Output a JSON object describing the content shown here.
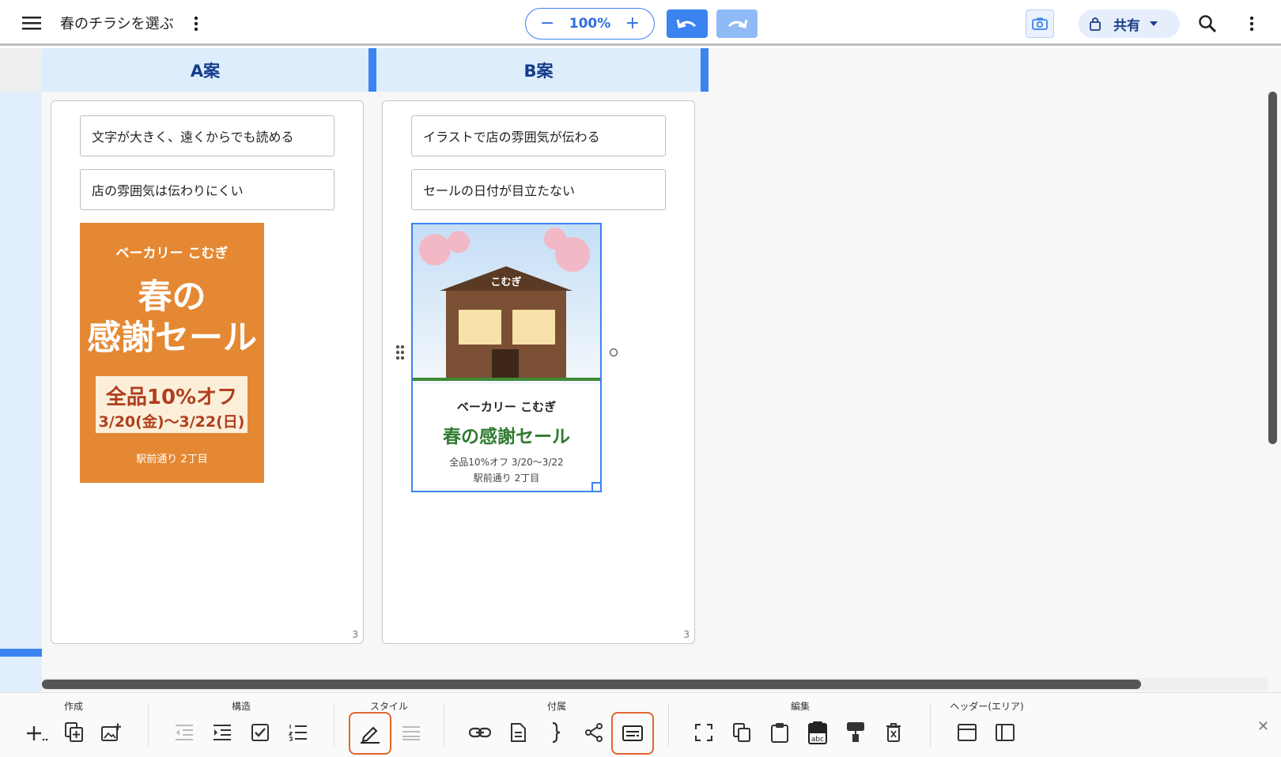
{
  "header": {
    "title": "春のチラシを選ぶ",
    "zoom": "100%",
    "share_label": "共有"
  },
  "columns": [
    {
      "title": "A案",
      "notes": [
        "文字が大きく、遠くからでも読める",
        "店の雰囲気は伝わりにくい"
      ],
      "page_number": "3",
      "flyer": {
        "shop": "ベーカリー こむぎ",
        "headline1": "春の",
        "headline2": "感謝セール",
        "offer": "全品10%オフ",
        "dates": "3/20(金)〜3/22(日)",
        "address": "駅前通り 2丁目"
      }
    },
    {
      "title": "B案",
      "notes": [
        "イラストで店の雰囲気が伝わる",
        "セールの日付が目立たない"
      ],
      "page_number": "3",
      "flyer": {
        "roof_label": "こむぎ",
        "shop": "ベーカリー こむぎ",
        "headline": "春の感謝セール",
        "offer_line": "全品10%オフ 3/20〜3/22",
        "address": "駅前通り 2丁目"
      }
    }
  ],
  "toolbar": {
    "groups": [
      "作成",
      "構造",
      "スタイル",
      "付属",
      "編集",
      "ヘッダー(エリア)"
    ]
  },
  "colors": {
    "accent": "#3a83f0",
    "flyer_orange": "#e58833",
    "flyer_green": "#2f7a30",
    "active_outline": "#e0662d"
  }
}
